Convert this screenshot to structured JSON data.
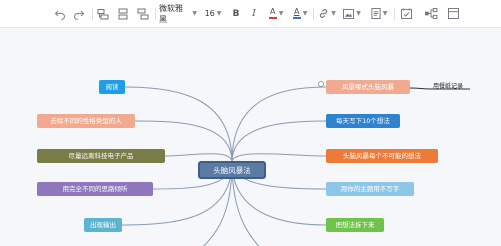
{
  "toolbar": {
    "undo_icon": "undo-icon",
    "redo_icon": "redo-icon",
    "font_family": "微软雅黑",
    "font_size": "16",
    "bold_label": "B",
    "italic_label": "I",
    "font_color_label": "A",
    "highlight_label": "A",
    "accent_font_color": "#e03e2d",
    "accent_highlight": "#3b6fd9"
  },
  "map": {
    "center": "头脑风暴法",
    "left": [
      {
        "label": "阅读",
        "color": "#1f9ee6"
      },
      {
        "label": "去除不同的性格类型的人",
        "color": "#f1a98f"
      },
      {
        "label": "尽量远离科技电子产品",
        "color": "#7a7c48"
      },
      {
        "label": "用完全不同的思路倾听",
        "color": "#8f77bd"
      },
      {
        "label": "出现输出",
        "color": "#5bb4d0"
      }
    ],
    "right": [
      {
        "label": "风景哪式头脑风暴",
        "color": "#f1a98f"
      },
      {
        "label": "每天写下10个想法",
        "color": "#2f82ce"
      },
      {
        "label": "头脑风暴每个不可能的想法",
        "color": "#ee7a3a"
      },
      {
        "label": "用你的主题用不写字",
        "color": "#8ec6e8"
      },
      {
        "label": "把想法拆下来",
        "color": "#6fc34a"
      }
    ],
    "callout": "用餐纸记录"
  }
}
